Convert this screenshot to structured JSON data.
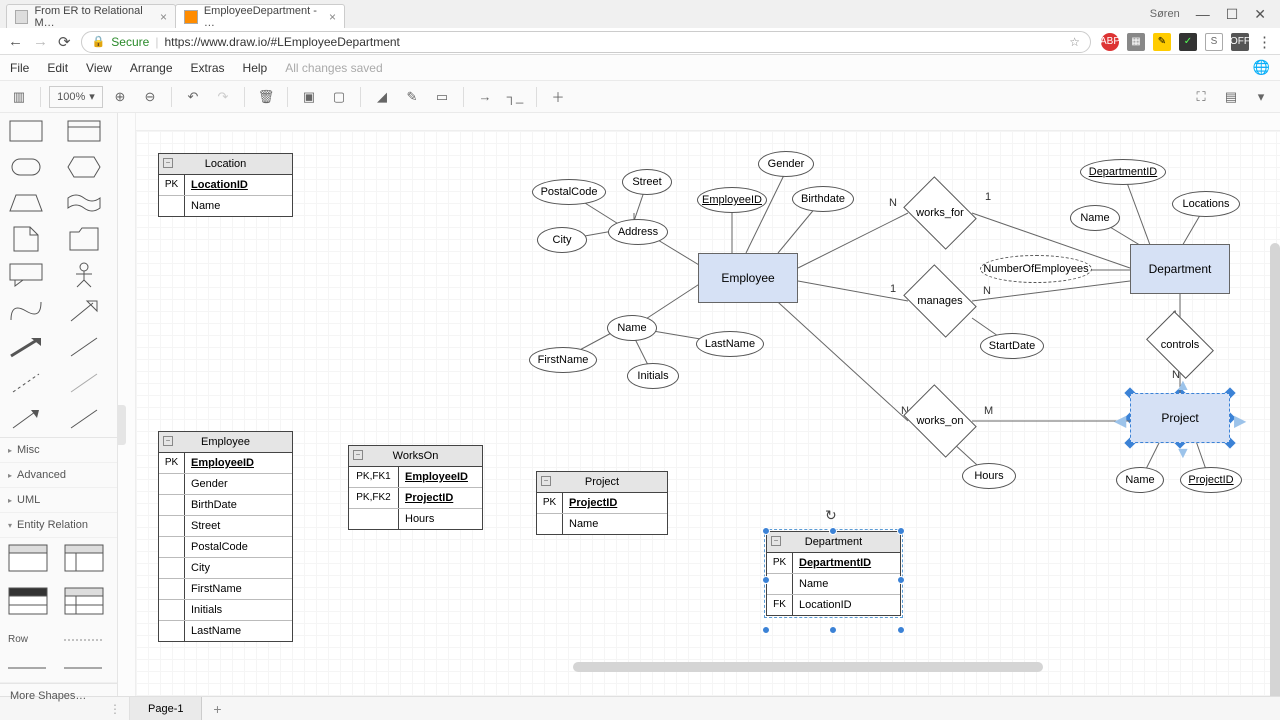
{
  "browser": {
    "tabs": [
      {
        "title": "From ER to Relational M…"
      },
      {
        "title": "EmployeeDepartment - …"
      }
    ],
    "user": "Søren",
    "win": {
      "min": "—",
      "max": "☐",
      "close": "✕"
    },
    "nav": {
      "back": "←",
      "fwd": "→",
      "reload": "⟳"
    },
    "secure": "Secure",
    "lock": "🔒",
    "url": "https://www.draw.io/#LEmployeeDepartment",
    "star": "☆",
    "menu": "⋮"
  },
  "menu": {
    "items": [
      "File",
      "Edit",
      "View",
      "Arrange",
      "Extras",
      "Help"
    ],
    "status": "All changes saved"
  },
  "toolbar": {
    "zoom": "100%",
    "zoom_caret": "▾",
    "icons": {
      "panel": "▥",
      "zin": "🔍+",
      "zout": "🔍−",
      "undo": "↶",
      "redo": "↷",
      "del": "🗑",
      "front": "▣",
      "back": "▢",
      "fill": "◢",
      "stroke": "✎",
      "shadow": "▭",
      "arrow": "→",
      "conn": "┐_",
      "plus": "＋",
      "fit": "⛶",
      "fmt": "▤",
      "coll": "▾"
    }
  },
  "sidebar": {
    "cats": [
      "Misc",
      "Advanced",
      "UML",
      "Entity Relation"
    ],
    "row_label": "Row",
    "more": "More Shapes…"
  },
  "tables": {
    "location": {
      "title": "Location",
      "rows": [
        [
          "PK",
          "LocationID",
          true
        ],
        [
          "",
          "Name",
          false
        ]
      ]
    },
    "employee": {
      "title": "Employee",
      "rows": [
        [
          "PK",
          "EmployeeID",
          true
        ],
        [
          "",
          "Gender",
          false
        ],
        [
          "",
          "BirthDate",
          false
        ],
        [
          "",
          "Street",
          false
        ],
        [
          "",
          "PostalCode",
          false
        ],
        [
          "",
          "City",
          false
        ],
        [
          "",
          "FirstName",
          false
        ],
        [
          "",
          "Initials",
          false
        ],
        [
          "",
          "LastName",
          false
        ]
      ]
    },
    "workson": {
      "title": "WorksOn",
      "rows": [
        [
          "PK,FK1",
          "EmployeeID",
          true
        ],
        [
          "PK,FK2",
          "ProjectID",
          true
        ],
        [
          "",
          "Hours",
          false
        ]
      ]
    },
    "project": {
      "title": "Project",
      "rows": [
        [
          "PK",
          "ProjectID",
          true
        ],
        [
          "",
          "Name",
          false
        ]
      ]
    },
    "department": {
      "title": "Department",
      "rows": [
        [
          "PK",
          "DepartmentID",
          true
        ],
        [
          "",
          "Name",
          false
        ],
        [
          "FK",
          "LocationID",
          false
        ]
      ]
    }
  },
  "er": {
    "employee": "Employee",
    "department": "Department",
    "project": "Project",
    "attrs": {
      "postal": "PostalCode",
      "street": "Street",
      "city": "City",
      "address": "Address",
      "gender": "Gender",
      "empid": "EmployeeID",
      "birth": "Birthdate",
      "name": "Name",
      "first": "FirstName",
      "last": "LastName",
      "init": "Initials",
      "deptid": "DepartmentID",
      "loc": "Locations",
      "dname": "Name",
      "numemp": "NumberOfEmployees",
      "start": "StartDate",
      "hours": "Hours",
      "pname": "Name",
      "pid": "ProjectID"
    },
    "rel": {
      "worksfor": "works_for",
      "manages": "manages",
      "workson": "works_on",
      "controls": "controls"
    },
    "card": {
      "n": "N",
      "one": "1",
      "m": "M"
    }
  },
  "footer": {
    "page": "Page-1",
    "add": "+",
    "grip": "⋮"
  },
  "rotate": "↻"
}
